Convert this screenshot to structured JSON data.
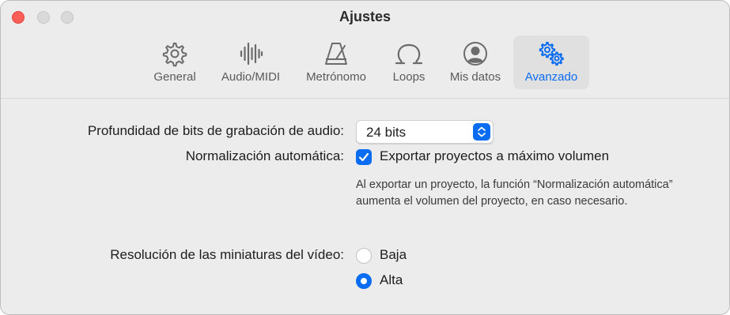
{
  "window": {
    "title": "Ajustes"
  },
  "toolbar": {
    "tabs": [
      {
        "label": "General",
        "icon": "gear-icon",
        "active": false
      },
      {
        "label": "Audio/MIDI",
        "icon": "waveform-icon",
        "active": false
      },
      {
        "label": "Metrónomo",
        "icon": "metronome-icon",
        "active": false
      },
      {
        "label": "Loops",
        "icon": "loop-icon",
        "active": false
      },
      {
        "label": "Mis datos",
        "icon": "person-circle-icon",
        "active": false
      },
      {
        "label": "Avanzado",
        "icon": "gears-icon",
        "active": true
      }
    ]
  },
  "settings": {
    "bit_depth": {
      "label": "Profundidad de bits de grabación de audio:",
      "value": "24 bits"
    },
    "normalization": {
      "label": "Normalización automática:",
      "checkbox_label": "Exportar proyectos a máximo volumen",
      "checked": true,
      "help_text": "Al exportar un proyecto, la función “Normalización automática” aumenta el volumen del proyecto, en caso necesario."
    },
    "video_thumbnails": {
      "label": "Resolución de las miniaturas del vídeo:",
      "options": [
        {
          "label": "Baja",
          "selected": false
        },
        {
          "label": "Alta",
          "selected": true
        }
      ]
    }
  },
  "colors": {
    "accent": "#0a6cf0",
    "close": "#ff5f57",
    "window_bg": "#ececec"
  }
}
